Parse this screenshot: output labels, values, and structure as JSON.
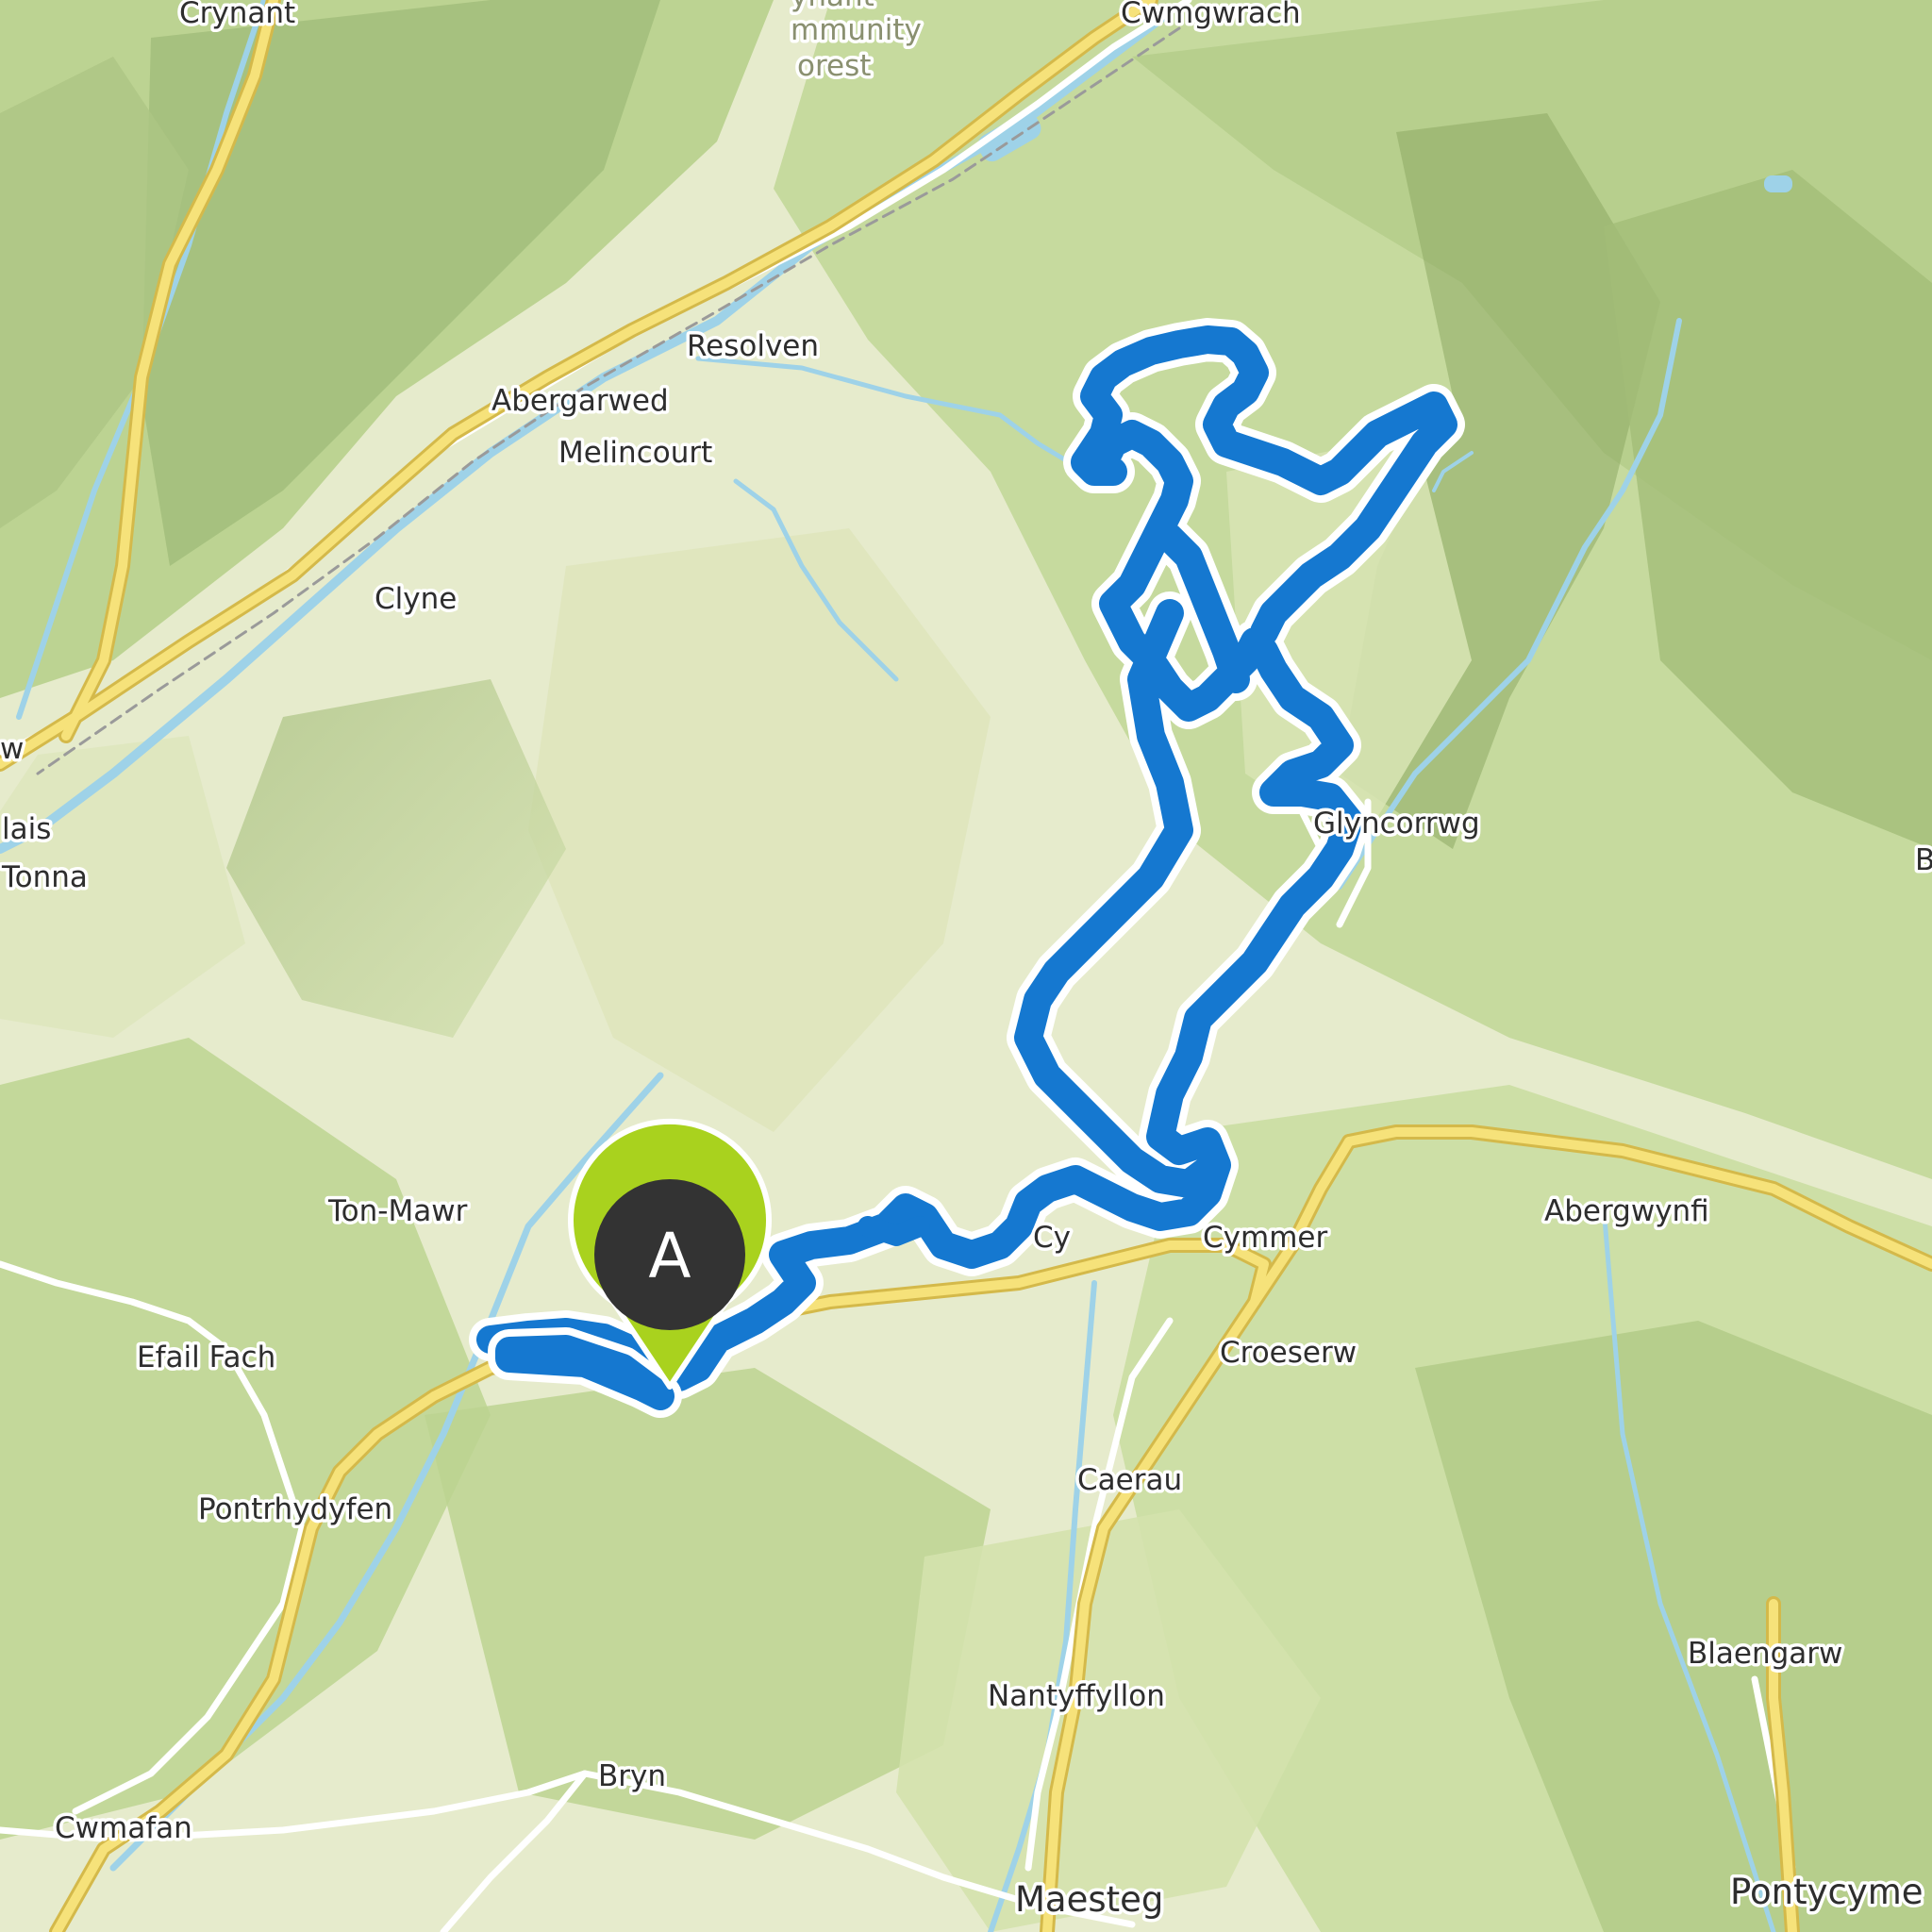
{
  "map": {
    "colors": {
      "background": "#e8ecd0",
      "forest": "#c9dca1",
      "forest_dark": "#b6cf8c",
      "ridge_shadow": "#8fa96a",
      "water": "#9ed2e8",
      "major_road": "#f6e27a",
      "minor_road": "#ffffff",
      "route": "#1578d0",
      "route_halo": "#ffffff",
      "marker_fill": "#a9d21e",
      "marker_inner": "#333333"
    },
    "labels": {
      "crynant": "Crynant",
      "community_forest": "mmunity",
      "community_forest_2": "orest",
      "community_forest_0": "ynant",
      "cwmgwrach": "Cwmgwrach",
      "resolven": "Resolven",
      "abergarwed": "Abergarwed",
      "melincourt": "Melincourt",
      "clyne": "Clyne",
      "glyncorrwg": "Glyncorrwg",
      "lais": "lais",
      "tonna": "Tonna",
      "ton_mawr": "Ton-Mawr",
      "efail_fach": "Efail Fach",
      "cymmer": "Cymmer",
      "cymmer_prefix": "Cy",
      "abergwynfi": "Abergwynfi",
      "croeserw": "Croeserw",
      "caerau": "Caerau",
      "pontrhydyfen": "Pontrhydyfen",
      "nantyffyllon": "Nantyffyllon",
      "blaengarw": "Blaengarw",
      "bryn": "Bryn",
      "cwmafan": "Cwmafan",
      "maesteg": "Maesteg",
      "pontycymer": "Pontycyme",
      "edge_w": "w",
      "edge_b": "B"
    },
    "start_marker": {
      "label": "A"
    }
  }
}
